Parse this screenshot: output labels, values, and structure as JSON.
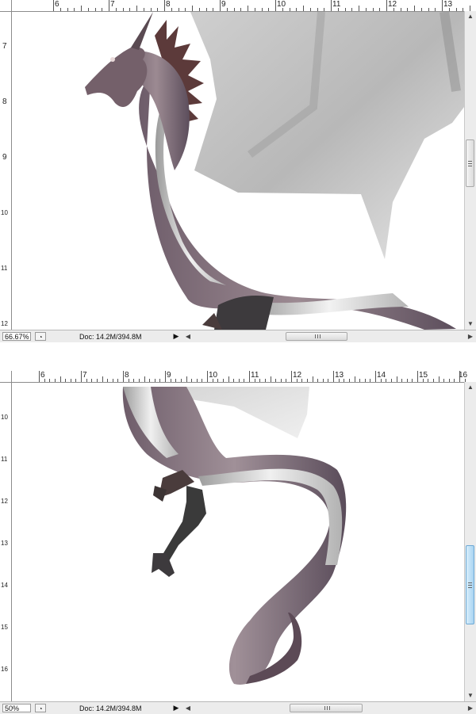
{
  "panel_top": {
    "zoom": "66.67%",
    "doc_info": "Doc: 14.2M/394.8M",
    "ruler_top_labels": [
      "6",
      "7",
      "8",
      "9",
      "10",
      "11",
      "12",
      "13"
    ],
    "ruler_left_labels": [
      "7",
      "8",
      "9",
      "10",
      "11",
      "12"
    ]
  },
  "panel_bottom": {
    "zoom": "50%",
    "doc_info": "Doc: 14.2M/394.8M",
    "ruler_top_labels": [
      "6",
      "7",
      "8",
      "9",
      "10",
      "11",
      "12",
      "13",
      "14",
      "15",
      "16"
    ],
    "ruler_left_labels": [
      "10",
      "11",
      "12",
      "13",
      "14",
      "15",
      "16"
    ]
  },
  "icons": {
    "status_menu": "triangle-right-icon",
    "scroll_left": "arrow-left-icon",
    "scroll_right": "arrow-right-icon",
    "scroll_up": "arrow-up-icon",
    "scroll_down": "arrow-down-icon"
  },
  "colors": {
    "scrollbar_active": "#a9d4f2",
    "chrome": "#ececec"
  }
}
